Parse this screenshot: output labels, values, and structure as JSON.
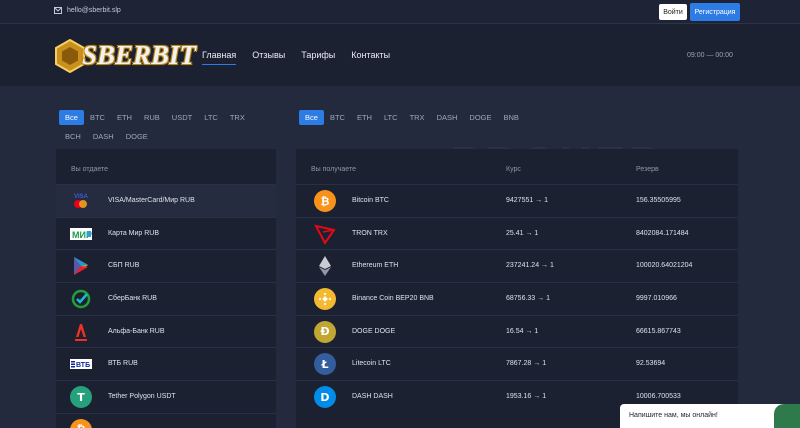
{
  "topbar": {
    "email": "hello@sberbit.slp",
    "login_label": "Войти",
    "register_label": "Регистрация"
  },
  "header": {
    "logo_text": "SBERBIT",
    "nav": [
      "Главная",
      "Отзывы",
      "Тарифы",
      "Контакты"
    ],
    "hours": "09:00 — 00:00"
  },
  "filters_give": [
    "Все",
    "BTC",
    "ETH",
    "RUB",
    "USDT",
    "LTC",
    "TRX",
    "BCH",
    "DASH",
    "DOGE"
  ],
  "filters_get": [
    "Все",
    "BTC",
    "ETH",
    "LTC",
    "TRX",
    "DASH",
    "DOGE",
    "BNB"
  ],
  "give": {
    "heading": "Вы отдаете",
    "items": [
      {
        "label": "VISA/MasterCard/Мир RUB",
        "icon": "visa-mastercard-icon"
      },
      {
        "label": "Карта Мир RUB",
        "icon": "mir-icon"
      },
      {
        "label": "СБП RUB",
        "icon": "sbp-icon"
      },
      {
        "label": "СберБанк RUB",
        "icon": "sberbank-icon"
      },
      {
        "label": "Альфа-Банк RUB",
        "icon": "alfa-bank-icon"
      },
      {
        "label": "ВТБ RUB",
        "icon": "vtb-icon"
      },
      {
        "label": "Tether Polygon USDT",
        "icon": "tether-icon"
      }
    ]
  },
  "get": {
    "heading": "Вы получаете",
    "rate_heading": "Курс",
    "reserve_heading": "Резерв",
    "items": [
      {
        "label": "Bitcoin BTC",
        "rate": "9427551 → 1",
        "reserve": "156.35505995",
        "icon": "bitcoin-icon",
        "color": "#f7931a"
      },
      {
        "label": "TRON TRX",
        "rate": "25.41 → 1",
        "reserve": "8402084.171484",
        "icon": "tron-icon",
        "color": "#e50914"
      },
      {
        "label": "Ethereum ETH",
        "rate": "237241.24 → 1",
        "reserve": "100020.64021204",
        "icon": "ethereum-icon",
        "color": "#9aa3b4"
      },
      {
        "label": "Binance Coin BEP20 BNB",
        "rate": "68756.33 → 1",
        "reserve": "9997.010966",
        "icon": "bnb-icon",
        "color": "#f3ba2f"
      },
      {
        "label": "DOGE DOGE",
        "rate": "16.54 → 1",
        "reserve": "66615.867743",
        "icon": "doge-icon",
        "color": "#c2a633"
      },
      {
        "label": "Litecoin LTC",
        "rate": "7867.28 → 1",
        "reserve": "92.53694",
        "icon": "litecoin-icon",
        "color": "#345d9d"
      },
      {
        "label": "DASH DASH",
        "rate": "1953.16 → 1",
        "reserve": "10006.700533",
        "icon": "dash-icon",
        "color": "#008ce7"
      }
    ]
  },
  "chat": {
    "text": "Напишите нам, мы онлайн!"
  },
  "colors": {
    "accent": "#2d7be5",
    "background": "#232a3e",
    "panel": "#1b2131"
  }
}
